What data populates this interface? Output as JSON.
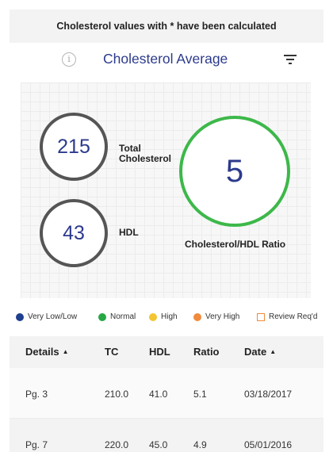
{
  "notice": "Cholesterol values with * have been calculated",
  "header": {
    "info_icon": "info-icon",
    "info_glyph": "i",
    "title": "Cholesterol Average",
    "filter_icon": "filter-icon"
  },
  "summary": {
    "total_cholesterol": {
      "value": "215",
      "label": "Total Cholesterol",
      "status_color": "#555555"
    },
    "hdl": {
      "value": "43",
      "label": "HDL",
      "status_color": "#555555"
    },
    "ratio": {
      "value": "5",
      "label": "Cholesterol/HDL Ratio",
      "status_color": "#3db84a"
    }
  },
  "legend": [
    {
      "label": "Very Low/Low",
      "color": "#1f3f8f",
      "shape": "dot"
    },
    {
      "label": "Normal",
      "color": "#27a844",
      "shape": "dot"
    },
    {
      "label": "High",
      "color": "#f2c531",
      "shape": "dot"
    },
    {
      "label": "Very High",
      "color": "#f08a3c",
      "shape": "dot"
    },
    {
      "label": "Review Req'd",
      "color": "#f08a3c",
      "shape": "square"
    }
  ],
  "table": {
    "columns": [
      {
        "label": "Details",
        "sortable": true
      },
      {
        "label": "TC",
        "sortable": false
      },
      {
        "label": "HDL",
        "sortable": false
      },
      {
        "label": "Ratio",
        "sortable": false
      },
      {
        "label": "Date",
        "sortable": true
      }
    ],
    "sort_glyph": "▲",
    "rows": [
      {
        "details": "Pg. 3",
        "tc": "210.0",
        "hdl": "41.0",
        "ratio": "5.1",
        "date": "03/18/2017"
      },
      {
        "details": "Pg. 7",
        "tc": "220.0",
        "hdl": "45.0",
        "ratio": "4.9",
        "date": "05/01/2016"
      }
    ]
  }
}
